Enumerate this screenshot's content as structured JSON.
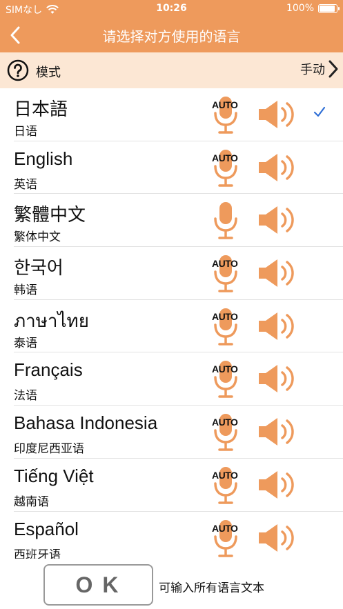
{
  "status_bar": {
    "carrier": "SIMなし",
    "time": "10:26",
    "battery": "100%"
  },
  "nav": {
    "title": "请选择对方使用的语言"
  },
  "mode_bar": {
    "label": "模式",
    "value": "手动"
  },
  "languages": [
    {
      "native": "日本語",
      "chinese": "日语",
      "auto": "AUTO",
      "selected": true
    },
    {
      "native": "English",
      "chinese": "英语",
      "auto": "AUTO",
      "selected": false
    },
    {
      "native": "繁體中文",
      "chinese": "繁体中文",
      "auto": "",
      "selected": false
    },
    {
      "native": "한국어",
      "chinese": "韩语",
      "auto": "AUTO",
      "selected": false
    },
    {
      "native": "ภาษาไทย",
      "chinese": "泰语",
      "auto": "AUTO",
      "selected": false
    },
    {
      "native": "Français",
      "chinese": "法语",
      "auto": "AUTO",
      "selected": false
    },
    {
      "native": "Bahasa Indonesia",
      "chinese": "印度尼西亚语",
      "auto": "AUTO",
      "selected": false
    },
    {
      "native": "Tiếng Việt",
      "chinese": "越南语",
      "auto": "AUTO",
      "selected": false
    },
    {
      "native": "Español",
      "chinese": "西班牙语",
      "auto": "AUTO",
      "selected": false
    }
  ],
  "footer": {
    "ok_label": "OK",
    "hint": "可输入所有语言文本"
  },
  "colors": {
    "accent": "#EE9A5C",
    "mode_bar_bg": "#FCE7D4",
    "check": "#2F6FD6"
  },
  "icons": {
    "back": "chevron-left-icon",
    "help": "question-circle-icon",
    "chevron": "chevron-right-icon",
    "mic": "microphone-icon",
    "speaker": "speaker-icon",
    "check": "checkmark-icon",
    "wifi": "wifi-icon",
    "battery": "battery-icon"
  }
}
